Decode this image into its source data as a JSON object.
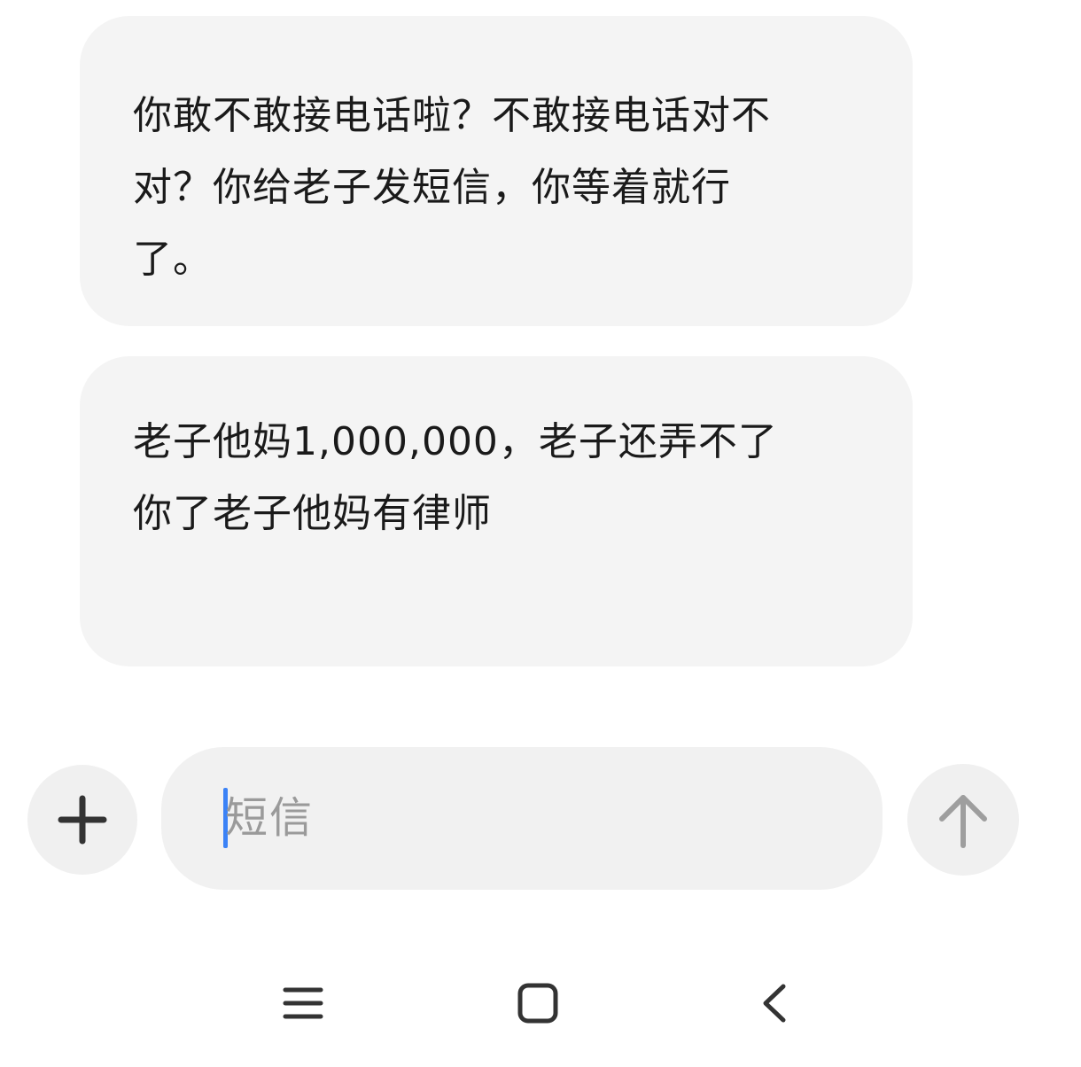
{
  "messages": [
    {
      "lines": [
        "你敢不敢接电话啦？不敢接电话对不",
        "对？你给老子发短信，你等着就行",
        "了。"
      ]
    },
    {
      "lines": [
        "老子他妈1,000,000，老子还弄不了",
        "你了老子他妈有律师"
      ]
    }
  ],
  "composer": {
    "placeholder": "短信",
    "add_icon": "plus-icon",
    "send_icon": "arrow-up-icon"
  },
  "navbar": {
    "icons": [
      "menu-icon",
      "home-icon",
      "back-icon"
    ]
  },
  "colors": {
    "bubble": "#f4f4f4",
    "caret": "#3b82f6",
    "icon_dark": "#333333",
    "icon_muted": "#9e9e9e"
  }
}
